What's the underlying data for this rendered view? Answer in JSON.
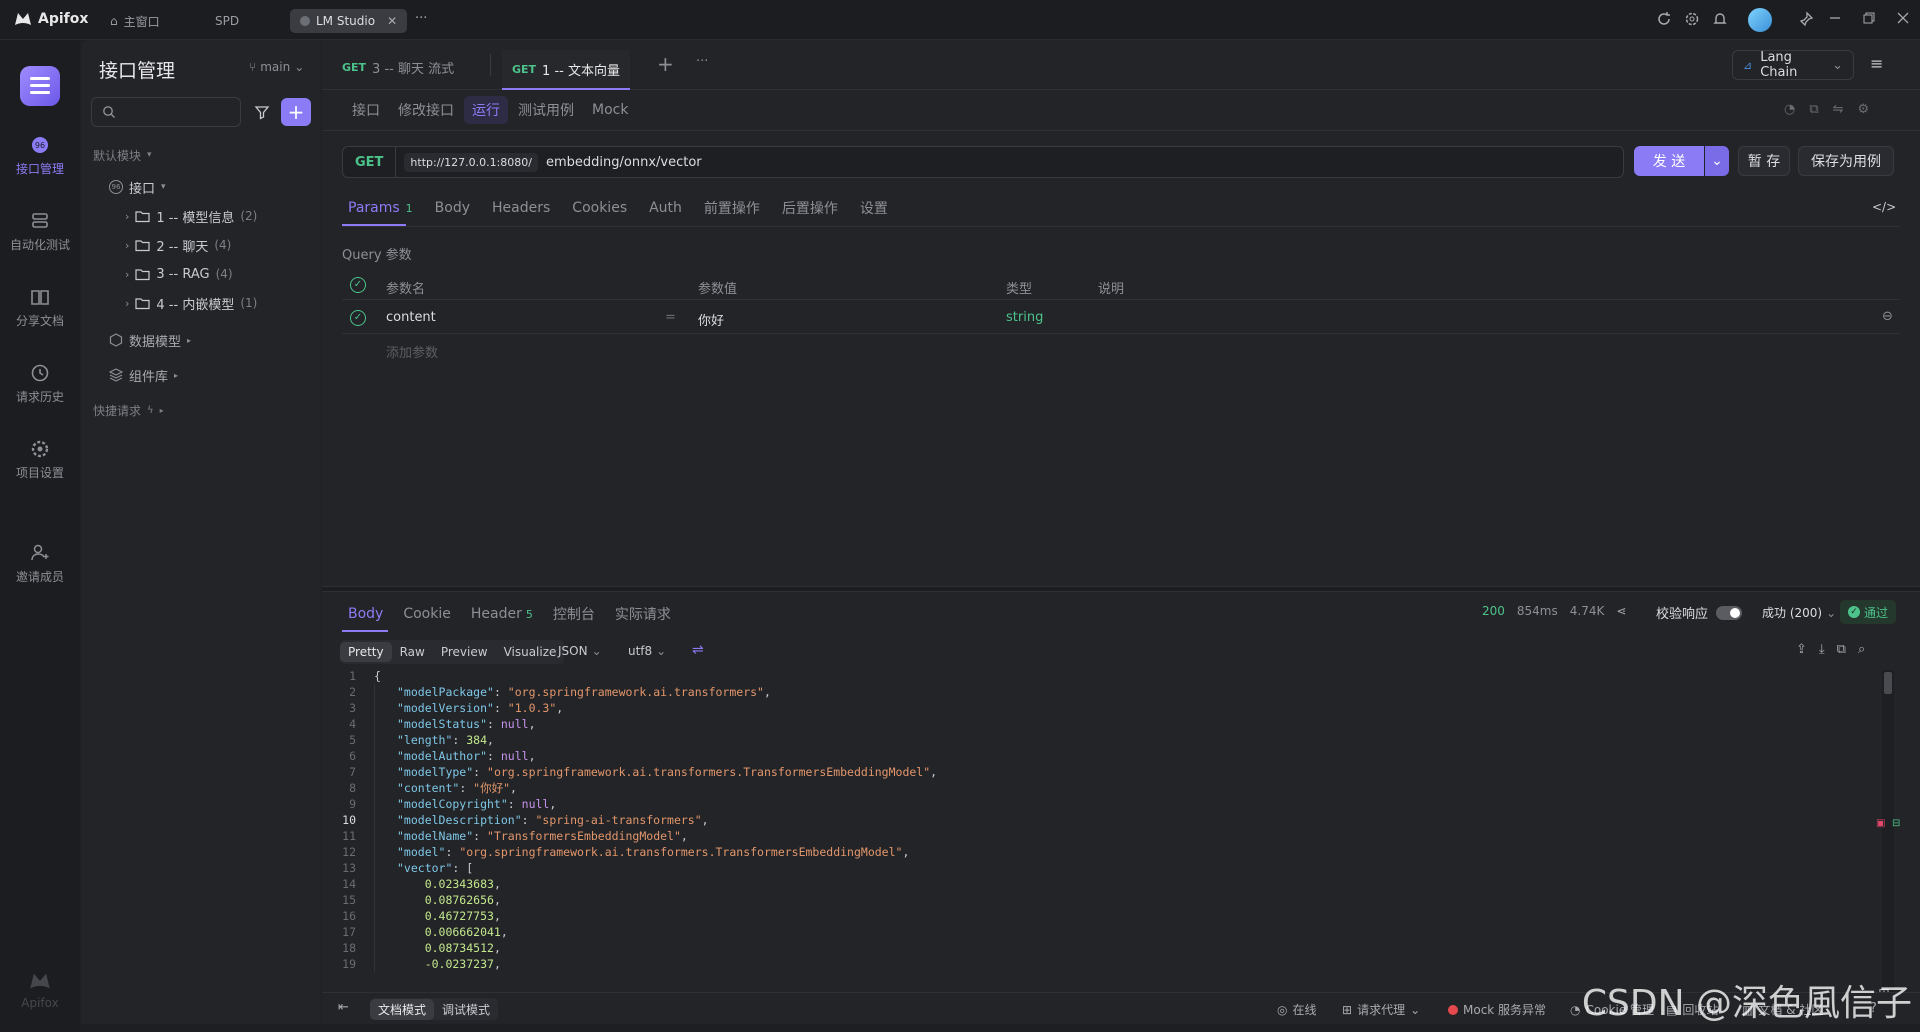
{
  "titlebar": {
    "brand": "Apifox",
    "tabs": [
      {
        "label": "主窗口"
      },
      {
        "label": "SPD"
      },
      {
        "label": "LM Studio"
      }
    ],
    "more": "···"
  },
  "rail": {
    "items": [
      {
        "label": "接口管理",
        "icon": "api-icon"
      },
      {
        "label": "自动化测试",
        "icon": "layers-icon"
      },
      {
        "label": "分享文档",
        "icon": "book-icon"
      },
      {
        "label": "请求历史",
        "icon": "clock-icon"
      },
      {
        "label": "项目设置",
        "icon": "gear-icon"
      },
      {
        "label": "邀请成员",
        "icon": "add-user-icon"
      }
    ],
    "footer": "Apifox"
  },
  "sidebar": {
    "title": "接口管理",
    "branch": "main",
    "default_module": "默认模块",
    "api_group": "接口",
    "folders": [
      {
        "name": "1 -- 模型信息",
        "count": "(2)"
      },
      {
        "name": "2 -- 聊天",
        "count": "(4)"
      },
      {
        "name": "3 -- RAG",
        "count": "(4)"
      },
      {
        "name": "4 -- 内嵌模型",
        "count": "(1)"
      }
    ],
    "data_model": "数据模型",
    "components": "组件库",
    "quick_request": "快捷请求"
  },
  "main": {
    "open_tabs": [
      {
        "method": "GET",
        "label": "3 -- 聊天 流式"
      },
      {
        "method": "GET",
        "label": "1 -- 文本向量"
      }
    ],
    "env": "Lang Chain",
    "sub_tabs": [
      "接口",
      "修改接口",
      "运行",
      "测试用例",
      "Mock"
    ],
    "request": {
      "method": "GET",
      "base_url": "http://127.0.0.1:8080/",
      "path": "embedding/onnx/vector",
      "send": "发 送",
      "save_temp": "暂 存",
      "save_case": "保存为用例"
    },
    "param_tabs": [
      {
        "label": "Params",
        "badge": "1"
      },
      {
        "label": "Body"
      },
      {
        "label": "Headers"
      },
      {
        "label": "Cookies"
      },
      {
        "label": "Auth"
      },
      {
        "label": "前置操作"
      },
      {
        "label": "后置操作"
      },
      {
        "label": "设置"
      }
    ],
    "query_title": "Query 参数",
    "query_headers": [
      "参数名",
      "参数值",
      "类型",
      "说明"
    ],
    "query_rows": [
      {
        "name": "content",
        "eq": "=",
        "value": "你好",
        "type": "string"
      }
    ],
    "add_param": "添加参数"
  },
  "response": {
    "tabs": [
      {
        "label": "Body"
      },
      {
        "label": "Cookie"
      },
      {
        "label": "Header",
        "badge": "5"
      },
      {
        "label": "控制台"
      },
      {
        "label": "实际请求"
      }
    ],
    "status": "200",
    "time": "854ms",
    "size": "4.74K",
    "validate_label": "校验响应",
    "result": "成功 (200)",
    "pass": "通过",
    "view_modes": [
      "Pretty",
      "Raw",
      "Preview",
      "Visualize"
    ],
    "format": "JSON",
    "encoding": "utf8",
    "code_lines": [
      {
        "n": "1",
        "parts": [
          [
            "pun",
            "{"
          ]
        ]
      },
      {
        "n": "2",
        "parts": [
          [
            "key",
            "\"modelPackage\""
          ],
          [
            "pun",
            ": "
          ],
          [
            "str",
            "\"org.springframework.ai.transformers\""
          ],
          [
            "pun",
            ","
          ]
        ]
      },
      {
        "n": "3",
        "parts": [
          [
            "key",
            "\"modelVersion\""
          ],
          [
            "pun",
            ": "
          ],
          [
            "str",
            "\"1.0.3\""
          ],
          [
            "pun",
            ","
          ]
        ]
      },
      {
        "n": "4",
        "parts": [
          [
            "key",
            "\"modelStatus\""
          ],
          [
            "pun",
            ": "
          ],
          [
            "nul",
            "null"
          ],
          [
            "pun",
            ","
          ]
        ]
      },
      {
        "n": "5",
        "parts": [
          [
            "key",
            "\"length\""
          ],
          [
            "pun",
            ": "
          ],
          [
            "num",
            "384"
          ],
          [
            "pun",
            ","
          ]
        ]
      },
      {
        "n": "6",
        "parts": [
          [
            "key",
            "\"modelAuthor\""
          ],
          [
            "pun",
            ": "
          ],
          [
            "nul",
            "null"
          ],
          [
            "pun",
            ","
          ]
        ]
      },
      {
        "n": "7",
        "parts": [
          [
            "key",
            "\"modelType\""
          ],
          [
            "pun",
            ": "
          ],
          [
            "str",
            "\"org.springframework.ai.transformers.TransformersEmbeddingModel\""
          ],
          [
            "pun",
            ","
          ]
        ]
      },
      {
        "n": "8",
        "parts": [
          [
            "key",
            "\"content\""
          ],
          [
            "pun",
            ": "
          ],
          [
            "str",
            "\"你好\""
          ],
          [
            "pun",
            ","
          ]
        ]
      },
      {
        "n": "9",
        "parts": [
          [
            "key",
            "\"modelCopyright\""
          ],
          [
            "pun",
            ": "
          ],
          [
            "nul",
            "null"
          ],
          [
            "pun",
            ","
          ]
        ]
      },
      {
        "n": "10",
        "parts": [
          [
            "key",
            "\"modelDescription\""
          ],
          [
            "pun",
            ": "
          ],
          [
            "str",
            "\"spring-ai-transformers\""
          ],
          [
            "pun",
            ","
          ]
        ]
      },
      {
        "n": "11",
        "parts": [
          [
            "key",
            "\"modelName\""
          ],
          [
            "pun",
            ": "
          ],
          [
            "str",
            "\"TransformersEmbeddingModel\""
          ],
          [
            "pun",
            ","
          ]
        ]
      },
      {
        "n": "12",
        "parts": [
          [
            "key",
            "\"model\""
          ],
          [
            "pun",
            ": "
          ],
          [
            "str",
            "\"org.springframework.ai.transformers.TransformersEmbeddingModel\""
          ],
          [
            "pun",
            ","
          ]
        ]
      },
      {
        "n": "13",
        "parts": [
          [
            "key",
            "\"vector\""
          ],
          [
            "pun",
            ": ["
          ]
        ]
      },
      {
        "n": "14",
        "parts": [
          [
            "num",
            "    0.02343683"
          ],
          [
            "pun",
            ","
          ]
        ]
      },
      {
        "n": "15",
        "parts": [
          [
            "num",
            "    0.08762656"
          ],
          [
            "pun",
            ","
          ]
        ]
      },
      {
        "n": "16",
        "parts": [
          [
            "num",
            "    0.46727753"
          ],
          [
            "pun",
            ","
          ]
        ]
      },
      {
        "n": "17",
        "parts": [
          [
            "num",
            "    0.006662041"
          ],
          [
            "pun",
            ","
          ]
        ]
      },
      {
        "n": "18",
        "parts": [
          [
            "num",
            "    0.08734512"
          ],
          [
            "pun",
            ","
          ]
        ]
      },
      {
        "n": "19",
        "parts": [
          [
            "num",
            "    -0.0237237"
          ],
          [
            "pun",
            ","
          ]
        ]
      }
    ]
  },
  "statusbar": {
    "doc_mode": "文档模式",
    "debug_mode": "调试模式",
    "online": "在线",
    "proxy": "请求代理",
    "mock": "Mock 服务异常",
    "cookie": "Cookie 管理",
    "recycle": "回收站",
    "docs": "文档 & 社区"
  },
  "watermark": "CSDN @深色風信子",
  "colors": {
    "accent": "#8b7cf6",
    "get": "#4cc38a",
    "bg": "#1e1f22"
  }
}
